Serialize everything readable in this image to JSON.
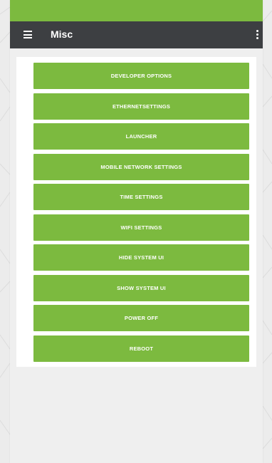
{
  "colors": {
    "accent": "#7cba3f",
    "toolbar": "#3d3f42",
    "background": "#efefef",
    "card": "#ffffff"
  },
  "toolbar": {
    "title": "Misc",
    "menu_icon": "hamburger-menu-icon",
    "overflow_icon": "more-vert-icon"
  },
  "buttons": [
    {
      "label": "DEVELOPER OPTIONS"
    },
    {
      "label": "ETHERNETSETTINGS"
    },
    {
      "label": "LAUNCHER"
    },
    {
      "label": "MOBILE NETWORK SETTINGS"
    },
    {
      "label": "TIME SETTINGS"
    },
    {
      "label": "WIFI SETTINGS"
    },
    {
      "label": "HIDE SYSTEM UI"
    },
    {
      "label": "SHOW SYSTEM UI"
    },
    {
      "label": "POWER OFF"
    },
    {
      "label": "REBOOT"
    }
  ]
}
